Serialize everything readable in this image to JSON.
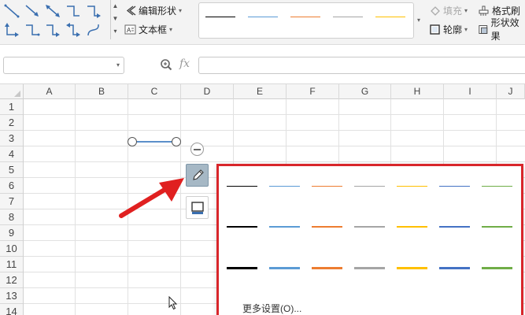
{
  "ribbon": {
    "edit_shape_label": "编辑形状",
    "textbox_label": "文本框",
    "fill_label": "填充",
    "format_painter_label": "格式刷",
    "outline_label": "轮廓",
    "shape_effects_label": "形状效果"
  },
  "ribbon_gallery_colors": [
    "#000000",
    "#5b9bd5",
    "#ed7d31",
    "#a5a5a5",
    "#ffc000"
  ],
  "formula_bar": {
    "fx_label": "fx",
    "name_box_value": "",
    "formula_value": ""
  },
  "columns": [
    "A",
    "B",
    "C",
    "D",
    "E",
    "F",
    "G",
    "H",
    "I",
    "J"
  ],
  "rows": [
    "1",
    "2",
    "3",
    "4",
    "5",
    "6",
    "7",
    "8",
    "9",
    "10",
    "11",
    "12",
    "13",
    "14"
  ],
  "line_panel": {
    "colors": [
      "#000000",
      "#5b9bd5",
      "#ed7d31",
      "#a5a5a5",
      "#ffc000",
      "#4472c4",
      "#70ad47"
    ],
    "more_settings_label": "更多设置(O)..."
  },
  "colors": {
    "annotation_arrow": "#e02020",
    "panel_border": "#d8262b",
    "shape_line": "#5b8fc9"
  },
  "icons": [
    "connector-line-icon",
    "edit-shape-icon",
    "textbox-icon",
    "fill-icon",
    "format-painter-icon",
    "outline-icon",
    "shape-effects-icon",
    "zoom-icon",
    "pencil-icon",
    "border-icon",
    "cursor-icon"
  ]
}
